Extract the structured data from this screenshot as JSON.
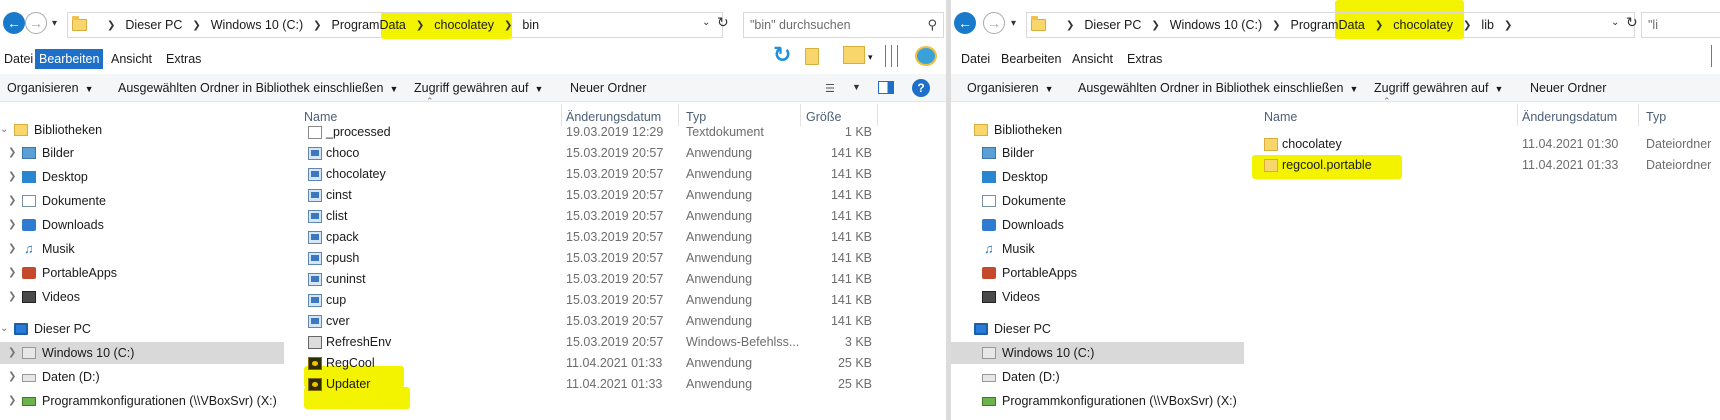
{
  "colors": {
    "accent": "#1979ca",
    "highlight": "#f3f300",
    "selection": "#d9d9d9",
    "header_text": "#4c607a",
    "meta_text": "#6d6d6d"
  },
  "icons": [
    "back-arrow-icon",
    "forward-arrow-icon",
    "folder-icon",
    "refresh-icon",
    "search-icon",
    "help-icon",
    "application-icon",
    "text-document-icon",
    "command-script-icon",
    "regcool-icon",
    "drive-icon",
    "network-drive-icon",
    "library-icon"
  ],
  "left": {
    "address": {
      "crumbs": [
        "Dieser PC",
        "Windows 10 (C:)",
        "ProgramData",
        "chocolatey",
        "bin"
      ],
      "search_placeholder": "\"bin\" durchsuchen"
    },
    "menu": [
      "Datei",
      "Bearbeiten",
      "Ansicht",
      "Extras"
    ],
    "menu_active": "Bearbeiten",
    "commands": [
      "Organisieren",
      "Ausgewählten Ordner in Bibliothek einschließen",
      "Zugriff gewähren auf",
      "Neuer Ordner"
    ],
    "columns": [
      "Name",
      "Änderungsdatum",
      "Typ",
      "Größe"
    ],
    "files": [
      {
        "name": "_processed",
        "date": "19.03.2019 12:29",
        "type": "Textdokument",
        "size": "1 KB",
        "icon": "text-document-icon"
      },
      {
        "name": "choco",
        "date": "15.03.2019 20:57",
        "type": "Anwendung",
        "size": "141 KB",
        "icon": "application-icon"
      },
      {
        "name": "chocolatey",
        "date": "15.03.2019 20:57",
        "type": "Anwendung",
        "size": "141 KB",
        "icon": "application-icon"
      },
      {
        "name": "cinst",
        "date": "15.03.2019 20:57",
        "type": "Anwendung",
        "size": "141 KB",
        "icon": "application-icon"
      },
      {
        "name": "clist",
        "date": "15.03.2019 20:57",
        "type": "Anwendung",
        "size": "141 KB",
        "icon": "application-icon"
      },
      {
        "name": "cpack",
        "date": "15.03.2019 20:57",
        "type": "Anwendung",
        "size": "141 KB",
        "icon": "application-icon"
      },
      {
        "name": "cpush",
        "date": "15.03.2019 20:57",
        "type": "Anwendung",
        "size": "141 KB",
        "icon": "application-icon"
      },
      {
        "name": "cuninst",
        "date": "15.03.2019 20:57",
        "type": "Anwendung",
        "size": "141 KB",
        "icon": "application-icon"
      },
      {
        "name": "cup",
        "date": "15.03.2019 20:57",
        "type": "Anwendung",
        "size": "141 KB",
        "icon": "application-icon"
      },
      {
        "name": "cver",
        "date": "15.03.2019 20:57",
        "type": "Anwendung",
        "size": "141 KB",
        "icon": "application-icon"
      },
      {
        "name": "RefreshEnv",
        "date": "15.03.2019 20:57",
        "type": "Windows-Befehlss...",
        "size": "3 KB",
        "icon": "command-script-icon"
      },
      {
        "name": "RegCool",
        "date": "11.04.2021 01:33",
        "type": "Anwendung",
        "size": "25 KB",
        "icon": "regcool-icon"
      },
      {
        "name": "Updater",
        "date": "11.04.2021 01:33",
        "type": "Anwendung",
        "size": "25 KB",
        "icon": "regcool-icon"
      }
    ]
  },
  "right": {
    "address": {
      "crumbs": [
        "Dieser PC",
        "Windows 10 (C:)",
        "ProgramData",
        "chocolatey",
        "lib"
      ],
      "search_partial": "\"li"
    },
    "menu": [
      "Datei",
      "Bearbeiten",
      "Ansicht",
      "Extras"
    ],
    "commands": [
      "Organisieren",
      "Ausgewählten Ordner in Bibliothek einschließen",
      "Zugriff gewähren auf",
      "Neuer Ordner"
    ],
    "columns": [
      "Name",
      "Änderungsdatum",
      "Typ"
    ],
    "files": [
      {
        "name": "chocolatey",
        "date": "11.04.2021 01:30",
        "type": "Dateiordner",
        "icon": "folder-icon"
      },
      {
        "name": "regcool.portable",
        "date": "11.04.2021 01:33",
        "type": "Dateiordner",
        "icon": "folder-icon"
      }
    ]
  },
  "tree": {
    "libraries": "Bibliotheken",
    "library_items": [
      "Bilder",
      "Desktop",
      "Dokumente",
      "Downloads",
      "Musik",
      "PortableApps",
      "Videos"
    ],
    "this_pc": "Dieser PC",
    "drives": [
      "Windows 10 (C:)",
      "Daten (D:)",
      "Programmkonfigurationen (\\\\VBoxSvr) (X:)"
    ],
    "selected_drive": "Windows 10 (C:)"
  }
}
